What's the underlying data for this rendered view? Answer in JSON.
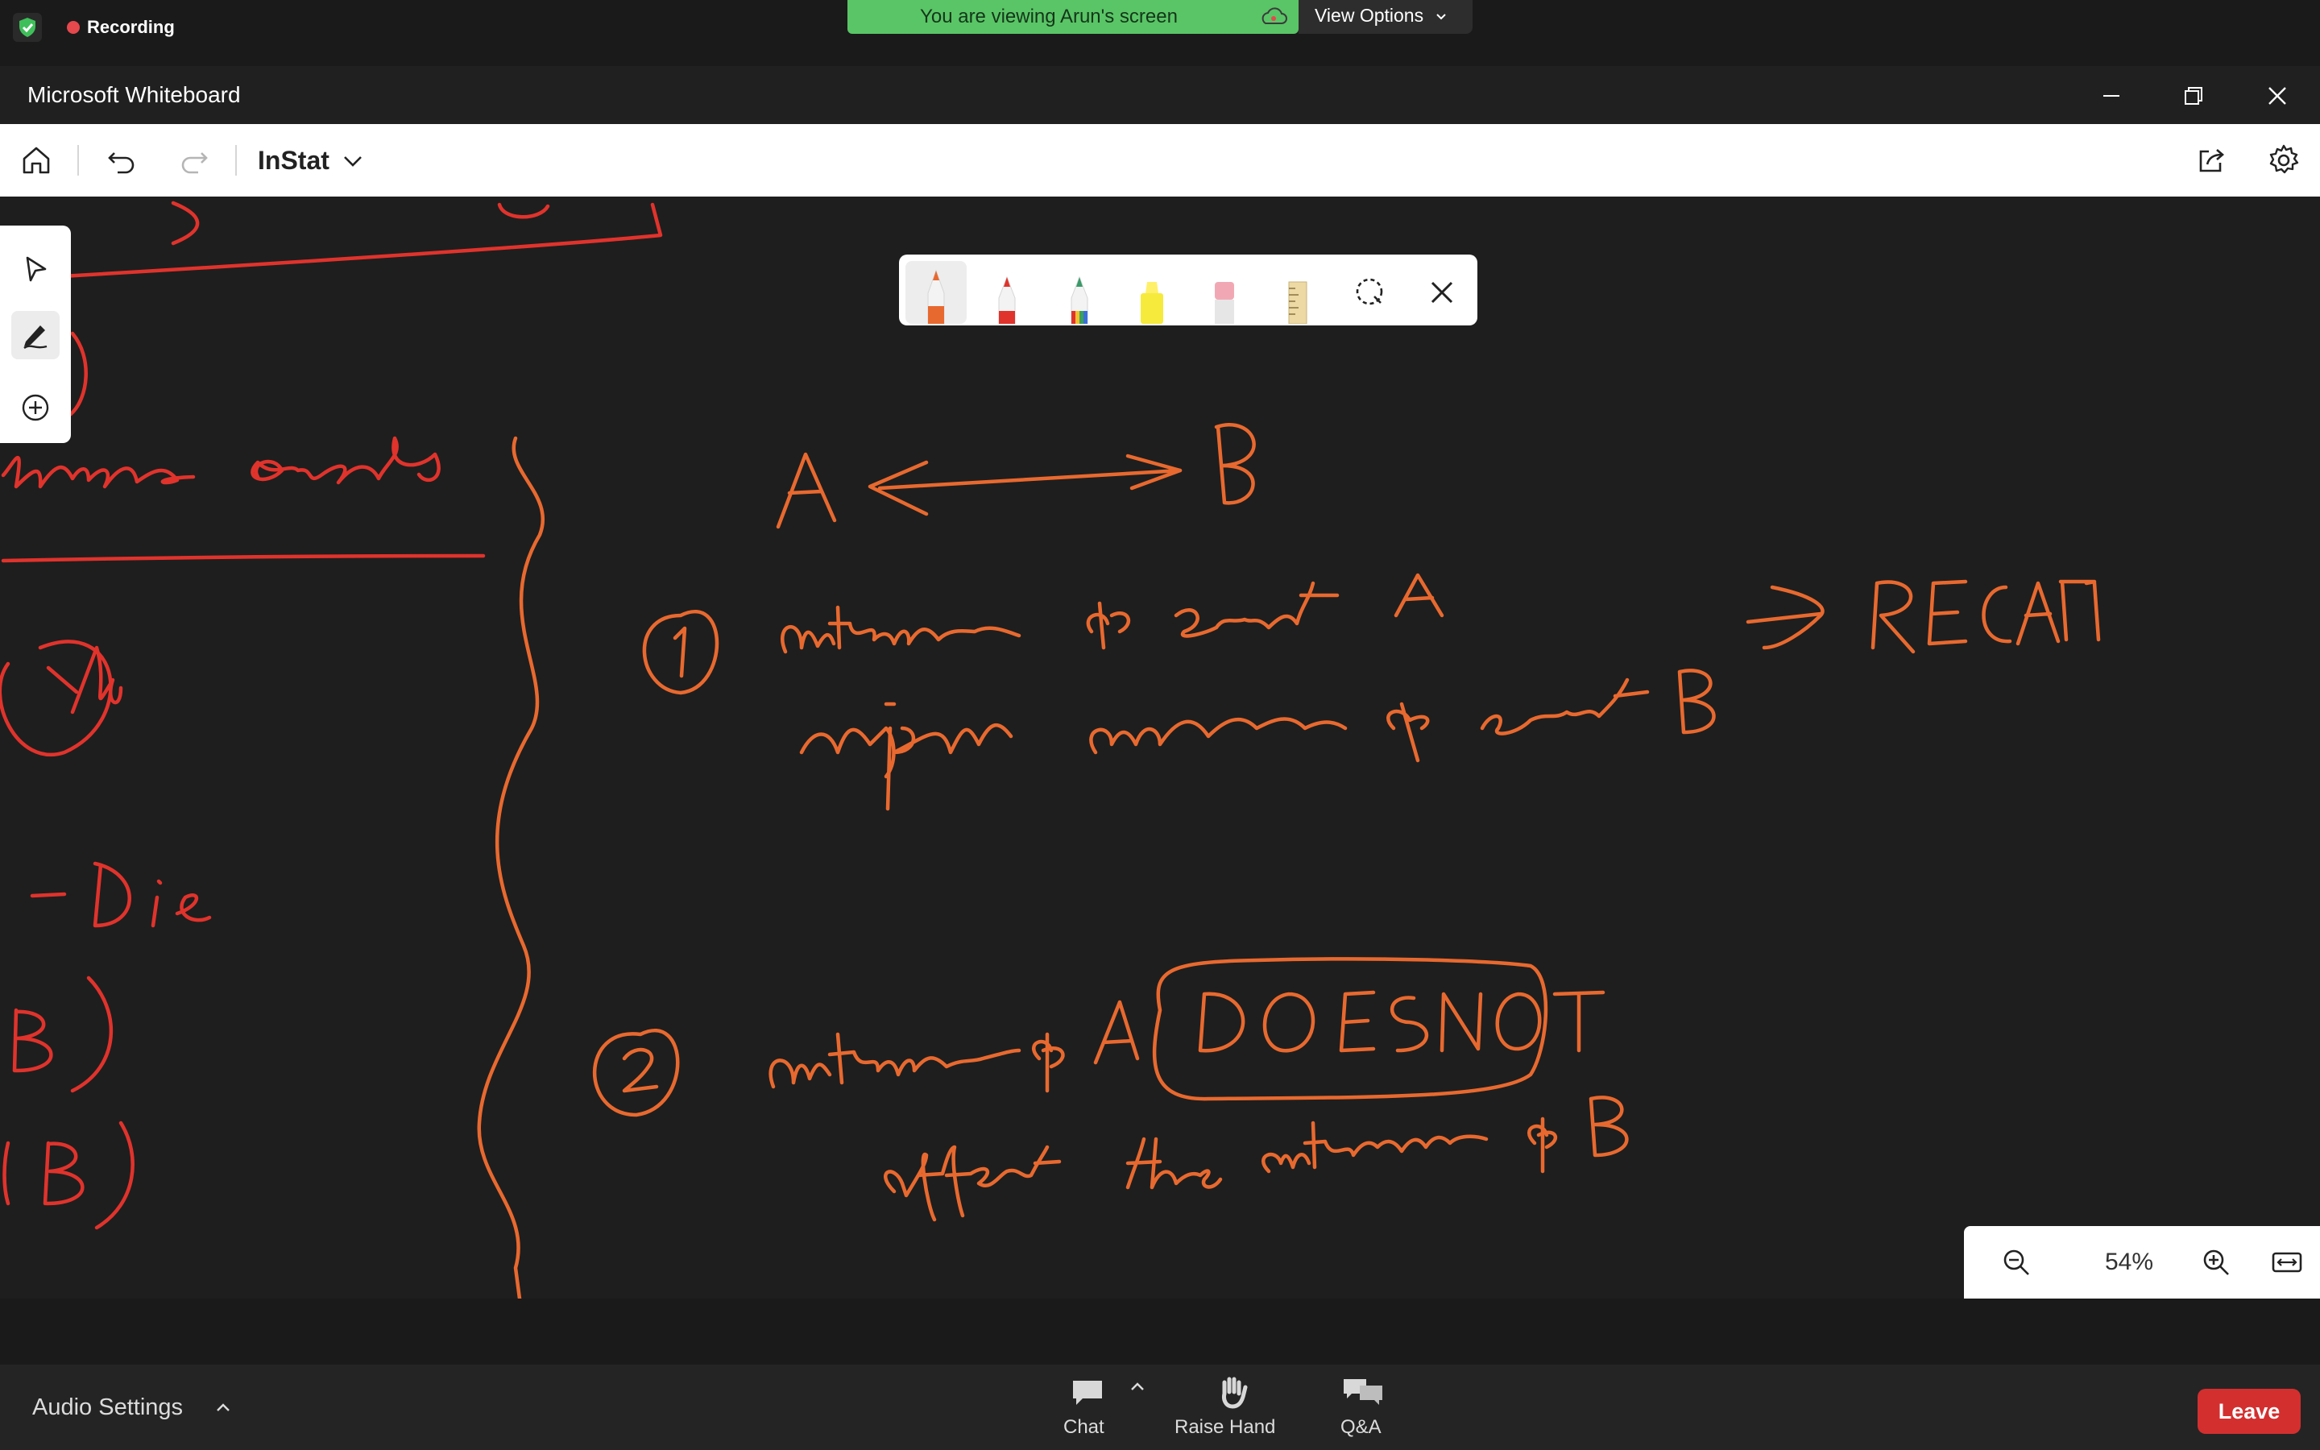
{
  "zoom_meeting": {
    "recording_label": "Recording",
    "share_banner": "You are viewing Arun's screen",
    "view_options": "View Options",
    "bottom_bar": {
      "audio_settings": "Audio Settings",
      "chat": "Chat",
      "raise_hand": "Raise Hand",
      "qa": "Q&A",
      "leave": "Leave"
    }
  },
  "whiteboard": {
    "app_title": "Microsoft Whiteboard",
    "board_name": "InStat",
    "zoom_level": "54%",
    "ink_colors": {
      "orange": "#e8692f",
      "red": "#e0332c"
    },
    "handwriting": {
      "left_heading": "...lusive events",
      "left_values": [
        "1/6",
        "- Die",
        "B)",
        "B)"
      ],
      "title": "A <—> B",
      "line1": "outcome of event A",
      "line2": "impacts outcome of event B",
      "line2_arrow_note": "RECALL",
      "line3_before_box": "outcome of A",
      "line3_boxed": "DOESNOT",
      "line4": "affect the outcome of B",
      "bullets": [
        "1",
        "2"
      ]
    },
    "pen_tray_tools": [
      "orange-pen",
      "red-pen",
      "rainbow-pen",
      "yellow-highlighter",
      "eraser",
      "ruler",
      "lasso-select",
      "close"
    ]
  }
}
